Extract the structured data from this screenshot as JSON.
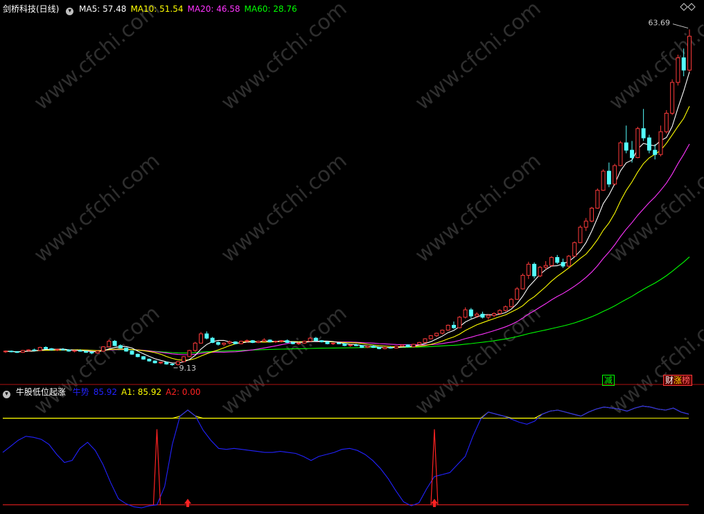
{
  "header": {
    "stock_name": "剑桥科技(日线)",
    "ma": [
      {
        "label": "MA5: 57.48",
        "color": "#ffffff"
      },
      {
        "label": "MA10: 51.54",
        "color": "#ffff00"
      },
      {
        "label": "MA20: 46.58",
        "color": "#ff33ff"
      },
      {
        "label": "MA60: 28.76",
        "color": "#00ff00"
      }
    ]
  },
  "indicator": {
    "name": "牛股低位起涨",
    "items": [
      {
        "label": "牛势",
        "color": "#2222ff"
      },
      {
        "label": "85.92",
        "color": "#2222ff"
      },
      {
        "label": "A1: 85.92",
        "color": "#ffff00"
      },
      {
        "label": "A2: 0.00",
        "color": "#ff2222"
      }
    ]
  },
  "tags": {
    "jian": "减",
    "cai": "财",
    "zhang": "涨",
    "bang": "榜"
  },
  "watermark": "www.cfchi.com",
  "chart_data": [
    {
      "type": "candlestick",
      "title": "剑桥科技(日线)",
      "ylim": [
        8.0,
        66.0
      ],
      "annotations": [
        {
          "label": "63.69",
          "kind": "high",
          "value": 63.69
        },
        {
          "label": "9.13",
          "kind": "low",
          "value": 9.13
        }
      ],
      "candles": [
        [
          11.4,
          11.6,
          11.2,
          11.5
        ],
        [
          11.5,
          11.6,
          11.3,
          11.4
        ],
        [
          11.4,
          11.5,
          11.2,
          11.3
        ],
        [
          11.3,
          11.7,
          11.2,
          11.6
        ],
        [
          11.6,
          11.8,
          11.4,
          11.7
        ],
        [
          11.7,
          11.9,
          11.5,
          11.6
        ],
        [
          11.6,
          12.2,
          11.5,
          12.1
        ],
        [
          12.1,
          12.3,
          11.8,
          11.9
        ],
        [
          11.9,
          12.0,
          11.6,
          11.7
        ],
        [
          11.7,
          11.9,
          11.5,
          11.8
        ],
        [
          11.8,
          12.0,
          11.6,
          11.7
        ],
        [
          11.7,
          11.8,
          11.4,
          11.5
        ],
        [
          11.5,
          11.7,
          11.3,
          11.6
        ],
        [
          11.6,
          11.8,
          11.4,
          11.5
        ],
        [
          11.5,
          11.6,
          11.2,
          11.3
        ],
        [
          11.3,
          11.4,
          11.0,
          11.2
        ],
        [
          11.2,
          11.6,
          11.1,
          11.5
        ],
        [
          11.5,
          12.3,
          11.4,
          12.2
        ],
        [
          12.2,
          13.4,
          12.1,
          13.1
        ],
        [
          13.1,
          13.3,
          12.3,
          12.4
        ],
        [
          12.4,
          12.6,
          11.9,
          12.0
        ],
        [
          12.0,
          12.1,
          11.4,
          11.5
        ],
        [
          11.5,
          11.6,
          10.9,
          11.0
        ],
        [
          11.0,
          11.1,
          10.5,
          10.6
        ],
        [
          10.6,
          10.7,
          10.1,
          10.2
        ],
        [
          10.2,
          10.3,
          9.8,
          9.9
        ],
        [
          9.9,
          10.0,
          9.5,
          9.6
        ],
        [
          9.6,
          9.8,
          9.4,
          9.7
        ],
        [
          9.7,
          9.8,
          9.3,
          9.4
        ],
        [
          9.4,
          9.5,
          9.13,
          9.3
        ],
        [
          9.3,
          9.9,
          9.2,
          9.8
        ],
        [
          9.8,
          10.7,
          9.7,
          10.6
        ],
        [
          10.6,
          11.7,
          10.5,
          11.6
        ],
        [
          11.6,
          13.0,
          11.4,
          12.8
        ],
        [
          12.8,
          14.6,
          12.7,
          14.3
        ],
        [
          14.3,
          14.7,
          13.4,
          13.6
        ],
        [
          13.6,
          13.8,
          12.8,
          12.9
        ],
        [
          12.9,
          13.1,
          12.4,
          12.6
        ],
        [
          12.6,
          12.9,
          12.3,
          12.8
        ],
        [
          12.8,
          13.2,
          12.6,
          13.0
        ],
        [
          13.0,
          13.1,
          12.6,
          12.7
        ],
        [
          12.7,
          13.2,
          12.6,
          13.1
        ],
        [
          13.1,
          13.4,
          12.9,
          13.2
        ],
        [
          13.2,
          13.3,
          12.8,
          12.9
        ],
        [
          12.9,
          13.2,
          12.8,
          13.1
        ],
        [
          13.1,
          13.6,
          13.0,
          13.3
        ],
        [
          13.3,
          13.4,
          12.9,
          13.0
        ],
        [
          13.0,
          13.2,
          12.8,
          13.1
        ],
        [
          13.1,
          13.3,
          12.9,
          13.2
        ],
        [
          13.2,
          13.4,
          12.8,
          12.9
        ],
        [
          12.9,
          13.1,
          12.6,
          12.7
        ],
        [
          12.7,
          13.0,
          12.5,
          12.8
        ],
        [
          12.8,
          13.2,
          12.7,
          13.1
        ],
        [
          13.1,
          13.8,
          13.0,
          13.6
        ],
        [
          13.6,
          13.8,
          13.1,
          13.2
        ],
        [
          13.2,
          13.3,
          12.9,
          13.0
        ],
        [
          13.0,
          13.1,
          12.6,
          12.7
        ],
        [
          12.7,
          12.9,
          12.5,
          12.8
        ],
        [
          12.8,
          13.0,
          12.6,
          12.7
        ],
        [
          12.7,
          12.8,
          12.3,
          12.4
        ],
        [
          12.4,
          12.6,
          12.2,
          12.5
        ],
        [
          12.5,
          12.7,
          12.3,
          12.4
        ],
        [
          12.4,
          12.5,
          12.0,
          12.1
        ],
        [
          12.1,
          12.4,
          12.0,
          12.3
        ],
        [
          12.3,
          12.5,
          12.0,
          12.1
        ],
        [
          12.1,
          12.2,
          11.8,
          11.9
        ],
        [
          11.9,
          12.2,
          11.8,
          12.1
        ],
        [
          12.1,
          12.3,
          11.9,
          12.0
        ],
        [
          12.0,
          12.4,
          11.9,
          12.3
        ],
        [
          12.3,
          12.6,
          12.2,
          12.5
        ],
        [
          12.5,
          12.6,
          12.1,
          12.2
        ],
        [
          12.2,
          12.7,
          12.1,
          12.6
        ],
        [
          12.6,
          13.0,
          12.5,
          12.9
        ],
        [
          12.9,
          13.6,
          12.8,
          13.5
        ],
        [
          13.5,
          14.1,
          13.4,
          14.0
        ],
        [
          14.0,
          14.5,
          13.8,
          14.4
        ],
        [
          14.4,
          15.0,
          14.2,
          14.9
        ],
        [
          14.9,
          15.8,
          14.8,
          15.7
        ],
        [
          15.7,
          16.3,
          15.1,
          15.3
        ],
        [
          15.3,
          17.2,
          15.2,
          17.0
        ],
        [
          17.0,
          18.6,
          16.8,
          18.2
        ],
        [
          18.2,
          18.5,
          16.8,
          17.2
        ],
        [
          17.2,
          17.8,
          16.9,
          17.5
        ],
        [
          17.5,
          17.9,
          16.8,
          17.0
        ],
        [
          17.0,
          17.5,
          16.6,
          17.3
        ],
        [
          17.3,
          17.8,
          17.0,
          17.6
        ],
        [
          17.6,
          18.3,
          17.4,
          18.1
        ],
        [
          18.1,
          18.9,
          17.9,
          18.7
        ],
        [
          18.7,
          20.1,
          18.6,
          19.9
        ],
        [
          19.9,
          21.9,
          19.8,
          21.6
        ],
        [
          21.6,
          24.1,
          21.5,
          23.8
        ],
        [
          23.8,
          26.0,
          23.2,
          25.6
        ],
        [
          25.6,
          25.9,
          23.3,
          23.7
        ],
        [
          23.7,
          25.3,
          23.5,
          25.1
        ],
        [
          25.1,
          26.1,
          24.7,
          25.4
        ],
        [
          25.4,
          26.9,
          25.2,
          26.7
        ],
        [
          26.7,
          27.1,
          25.6,
          25.9
        ],
        [
          25.9,
          26.5,
          25.0,
          25.3
        ],
        [
          25.3,
          27.1,
          25.1,
          26.9
        ],
        [
          26.9,
          29.3,
          26.8,
          29.1
        ],
        [
          29.1,
          31.9,
          29.0,
          31.6
        ],
        [
          31.6,
          33.1,
          31.0,
          32.6
        ],
        [
          32.6,
          34.9,
          32.4,
          34.7
        ],
        [
          34.7,
          37.9,
          34.6,
          37.6
        ],
        [
          37.6,
          41.0,
          37.5,
          40.7
        ],
        [
          40.7,
          42.1,
          38.1,
          38.6
        ],
        [
          38.6,
          41.9,
          38.4,
          41.6
        ],
        [
          41.6,
          45.6,
          41.5,
          45.3
        ],
        [
          45.3,
          48.1,
          43.6,
          44.1
        ],
        [
          44.1,
          45.6,
          42.1,
          42.9
        ],
        [
          42.9,
          47.9,
          42.8,
          47.6
        ],
        [
          47.6,
          50.8,
          45.6,
          46.1
        ],
        [
          46.1,
          46.6,
          43.6,
          44.1
        ],
        [
          44.1,
          45.1,
          42.6,
          43.4
        ],
        [
          43.4,
          48.1,
          43.1,
          47.1
        ],
        [
          47.1,
          50.6,
          46.8,
          50.1
        ],
        [
          50.1,
          55.6,
          49.8,
          55.1
        ],
        [
          55.1,
          59.6,
          54.6,
          59.1
        ],
        [
          59.1,
          60.6,
          56.1,
          57.1
        ],
        [
          57.1,
          63.69,
          56.8,
          62.6
        ]
      ],
      "ma": {
        "MA5": {
          "last": 57.48,
          "color": "#ffffff"
        },
        "MA10": {
          "last": 51.54,
          "color": "#ffff00"
        },
        "MA20": {
          "last": 46.58,
          "color": "#ff33ff"
        },
        "MA60": {
          "last": 28.76,
          "color": "#00ff00"
        }
      },
      "up_color": "#ff3b3b",
      "down_color": "#54ffff"
    },
    {
      "type": "line",
      "title": "牛股低位起涨",
      "ylim": [
        -5,
        105
      ],
      "reference_lines": [
        85.92,
        0
      ],
      "series": [
        {
          "name": "牛势",
          "color": "#2222ff",
          "values": [
            52,
            58,
            64,
            68,
            67,
            65,
            60,
            50,
            42,
            44,
            56,
            62,
            54,
            40,
            22,
            6,
            1,
            -2,
            -3,
            -1,
            0,
            18,
            60,
            88,
            94,
            88,
            74,
            64,
            56,
            55,
            56,
            55,
            54,
            53,
            52,
            52,
            53,
            52,
            51,
            48,
            44,
            48,
            50,
            52,
            55,
            56,
            54,
            50,
            44,
            36,
            26,
            14,
            3,
            -1,
            2,
            16,
            28,
            30,
            32,
            40,
            48,
            68,
            85,
            92,
            90,
            88,
            85,
            82,
            80,
            83,
            90,
            93,
            94,
            92,
            90,
            88,
            92,
            95,
            97,
            96,
            95,
            93,
            96,
            98,
            97,
            95,
            94,
            96,
            92,
            90
          ]
        },
        {
          "name": "A1",
          "color": "#ffff00",
          "values": [
            85.92,
            85.92,
            85.92,
            85.92,
            85.92,
            85.92,
            85.92,
            85.92,
            85.92,
            85.92,
            85.92,
            85.92,
            85.92,
            85.92,
            85.92,
            85.92,
            85.92,
            85.92,
            85.92,
            85.92,
            85.92,
            85.92,
            85.92,
            88,
            94,
            88,
            85.92,
            85.92,
            85.92,
            85.92,
            85.92,
            85.92,
            85.92,
            85.92,
            85.92,
            85.92,
            85.92,
            85.92,
            85.92,
            85.92,
            85.92,
            85.92,
            85.92,
            85.92,
            85.92,
            85.92,
            85.92,
            85.92,
            85.92,
            85.92,
            85.92,
            85.92,
            85.92,
            85.92,
            85.92,
            85.92,
            85.92,
            85.92,
            85.92,
            85.92,
            85.92,
            85.92,
            85.92,
            92,
            90,
            88,
            86,
            86,
            86,
            86,
            90,
            93,
            94,
            92,
            90,
            88,
            92,
            95,
            97,
            96,
            95,
            93,
            96,
            98,
            97,
            95,
            94,
            96,
            92,
            90
          ]
        },
        {
          "name": "A2",
          "color": "#ff2222",
          "spikes": [
            {
              "index": 20,
              "value": 75
            },
            {
              "index": 56,
              "value": 75
            }
          ],
          "last": 0.0
        }
      ],
      "signals": [
        {
          "index": 24,
          "kind": "up-arrow"
        },
        {
          "index": 56,
          "kind": "up-arrow"
        }
      ]
    }
  ]
}
